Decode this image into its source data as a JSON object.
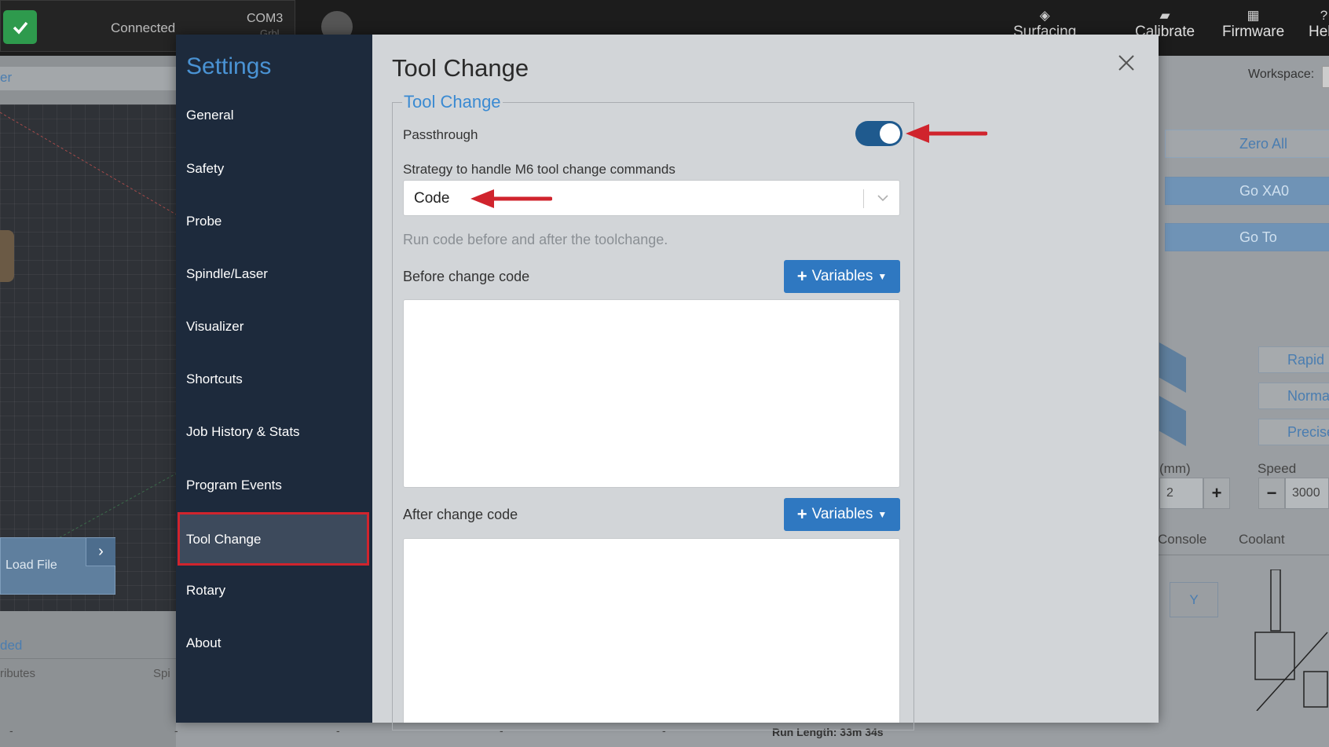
{
  "app": {
    "connection": {
      "status": "Connected",
      "port": "COM3",
      "port_sub": "Grbl"
    },
    "nav": [
      {
        "label": "Surfacing",
        "icon": "surfacing-icon"
      },
      {
        "label": "Calibrate",
        "icon": "ruler-icon"
      },
      {
        "label": "Firmware",
        "icon": "chip-icon"
      },
      {
        "label": "Help",
        "icon": "help-icon"
      }
    ],
    "left_panel": {
      "tab_label": "er",
      "load_file": "Load File",
      "loaded_label": "ded",
      "attributes_label": "ributes",
      "spindle_label": "Spi"
    },
    "bottom": {
      "run_length": "Run Length: 33m 34s",
      "dash": "-"
    },
    "right_panel": {
      "workspace_label": "Workspace:",
      "zero_all": "Zero All",
      "go_xa0": "Go XA0",
      "go_to": "Go To",
      "jog_z_plus": "Z+",
      "jog_z_minus": "Z-",
      "speed_modes": [
        "Rapid",
        "Normal",
        "Precise"
      ],
      "step_label": "(mm)",
      "speed_label": "Speed (mm/min)",
      "step_value": "2",
      "speed_value": "3000",
      "plus": "+",
      "minus": "−",
      "tabs": [
        "Console",
        "Coolant"
      ],
      "y_button": "Y"
    }
  },
  "settings": {
    "title": "Settings",
    "menu": [
      "General",
      "Safety",
      "Probe",
      "Spindle/Laser",
      "Visualizer",
      "Shortcuts",
      "Job History & Stats",
      "Program Events",
      "Tool Change",
      "Rotary",
      "About"
    ],
    "active": "Tool Change"
  },
  "tool_change": {
    "page_title": "Tool Change",
    "section_title": "Tool Change",
    "passthrough_label": "Passthrough",
    "passthrough_on": true,
    "strategy_label": "Strategy to handle M6 tool change commands",
    "strategy_value": "Code",
    "strategy_hint": "Run code before and after the toolchange.",
    "before_label": "Before change code",
    "after_label": "After change code",
    "variables_label": "Variables",
    "before_code": "",
    "after_code": ""
  },
  "colors": {
    "accent": "#2f78c1",
    "title_blue": "#3a8ad2",
    "sidebar": "#1d2a3c",
    "annotation_red": "#d0242d",
    "toggle_on": "#1f5a8e"
  }
}
